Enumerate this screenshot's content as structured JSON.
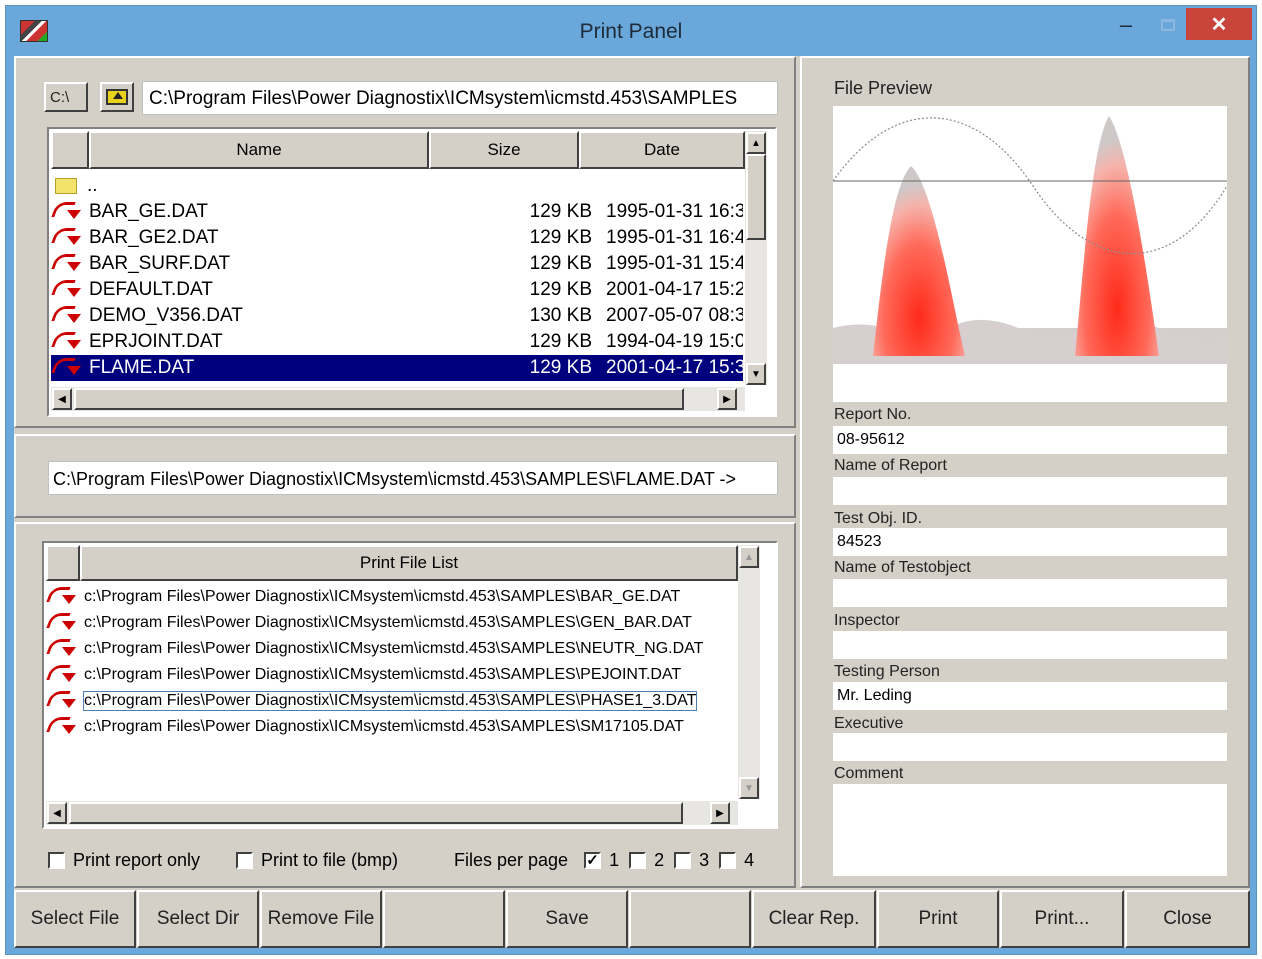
{
  "window": {
    "title": "Print Panel",
    "minimize_glyph": "–",
    "close_glyph": "✕"
  },
  "browser": {
    "drive_label": "C:\\",
    "path": "C:\\Program Files\\Power Diagnostix\\ICMsystem\\icmstd.453\\SAMPLES",
    "columns": [
      "Name",
      "Size",
      "Date"
    ],
    "parent_label": "..",
    "files": [
      {
        "name": "BAR_GE.DAT",
        "size": "129 KB",
        "date": "1995-01-31 16:3"
      },
      {
        "name": "BAR_GE2.DAT",
        "size": "129 KB",
        "date": "1995-01-31 16:4"
      },
      {
        "name": "BAR_SURF.DAT",
        "size": "129 KB",
        "date": "1995-01-31 15:4"
      },
      {
        "name": "DEFAULT.DAT",
        "size": "129 KB",
        "date": "2001-04-17 15:2"
      },
      {
        "name": "DEMO_V356.DAT",
        "size": "130 KB",
        "date": "2007-05-07 08:3"
      },
      {
        "name": "EPRJOINT.DAT",
        "size": "129 KB",
        "date": "1994-04-19 15:0"
      },
      {
        "name": "FLAME.DAT",
        "size": "129 KB",
        "date": "2001-04-17 15:3"
      }
    ],
    "selected_index": 6
  },
  "target_path": "C:\\Program Files\\Power Diagnostix\\ICMsystem\\icmstd.453\\SAMPLES\\FLAME.DAT ->",
  "print_list": {
    "header": "Print File List",
    "items": [
      "c:\\Program Files\\Power Diagnostix\\ICMsystem\\icmstd.453\\SAMPLES\\BAR_GE.DAT",
      "c:\\Program Files\\Power Diagnostix\\ICMsystem\\icmstd.453\\SAMPLES\\GEN_BAR.DAT",
      "c:\\Program Files\\Power Diagnostix\\ICMsystem\\icmstd.453\\SAMPLES\\NEUTR_NG.DAT",
      "c:\\Program Files\\Power Diagnostix\\ICMsystem\\icmstd.453\\SAMPLES\\PEJOINT.DAT",
      "c:\\Program Files\\Power Diagnostix\\ICMsystem\\icmstd.453\\SAMPLES\\PHASE1_3.DAT",
      "c:\\Program Files\\Power Diagnostix\\ICMsystem\\icmstd.453\\SAMPLES\\SM17105.DAT"
    ],
    "focused_index": 4
  },
  "options": {
    "print_report_only": {
      "label": "Print report only",
      "checked": false
    },
    "print_to_file": {
      "label": "Print to file (bmp)",
      "checked": false
    },
    "files_per_page_label": "Files per page",
    "files_per_page": [
      {
        "label": "1",
        "checked": true
      },
      {
        "label": "2",
        "checked": false
      },
      {
        "label": "3",
        "checked": false
      },
      {
        "label": "4",
        "checked": false
      }
    ]
  },
  "preview": {
    "label": "File Preview"
  },
  "report": {
    "report_no": {
      "label": "Report No.",
      "value": "08-95612"
    },
    "name_of_report": {
      "label": "Name of Report",
      "value": ""
    },
    "test_obj_id": {
      "label": "Test Obj. ID.",
      "value": "84523"
    },
    "name_of_testobject": {
      "label": "Name of Testobject",
      "value": ""
    },
    "inspector": {
      "label": "Inspector",
      "value": ""
    },
    "testing_person": {
      "label": "Testing Person",
      "value": "Mr. Leding"
    },
    "executive": {
      "label": "Executive",
      "value": ""
    },
    "comment": {
      "label": "Comment",
      "value": ""
    }
  },
  "buttons": {
    "select_file": "Select File",
    "select_dir": "Select Dir",
    "remove_file": "Remove File",
    "blank1": "",
    "save": "Save",
    "blank2": "",
    "clear_rep": "Clear Rep.",
    "print": "Print",
    "print_dialog": "Print...",
    "close": "Close"
  }
}
